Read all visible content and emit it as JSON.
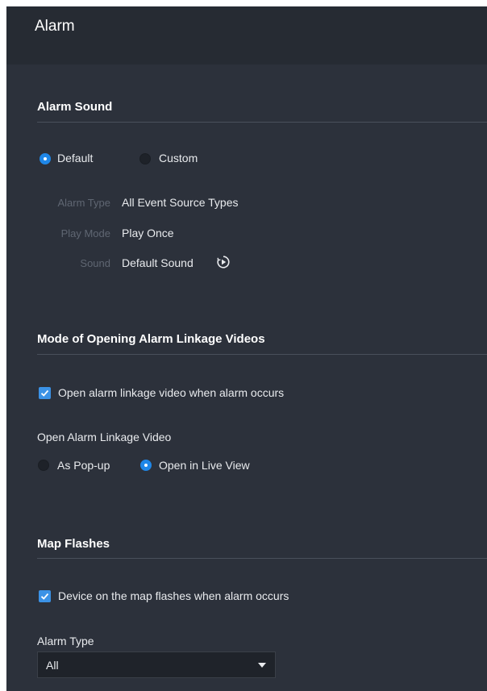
{
  "header": {
    "title": "Alarm"
  },
  "alarm_sound": {
    "title": "Alarm Sound",
    "options": [
      {
        "label": "Default",
        "selected": true
      },
      {
        "label": "Custom",
        "selected": false
      }
    ],
    "fields": [
      {
        "label": "Alarm Type",
        "value": "All Event Source Types"
      },
      {
        "label": "Play Mode",
        "value": "Play Once"
      },
      {
        "label": "Sound",
        "value": "Default Sound"
      }
    ],
    "play_icon": "play-circle-icon"
  },
  "linkage": {
    "title": "Mode of Opening Alarm Linkage Videos",
    "checkbox_label": "Open alarm linkage video when alarm occurs",
    "checkbox_checked": true,
    "sub_label": "Open Alarm Linkage Video",
    "options": [
      {
        "label": "As Pop-up",
        "selected": false
      },
      {
        "label": "Open in Live View",
        "selected": true
      }
    ]
  },
  "map_flashes": {
    "title": "Map Flashes",
    "checkbox_label": "Device on the map flashes when alarm occurs",
    "checkbox_checked": true,
    "alarm_type_label": "Alarm Type",
    "alarm_type_value": "All"
  },
  "colors": {
    "panel_bg": "#2c313b",
    "header_bg": "#262b33",
    "accent": "#1f87e8",
    "text": "#e9ebee",
    "muted_label": "#5f6672"
  }
}
